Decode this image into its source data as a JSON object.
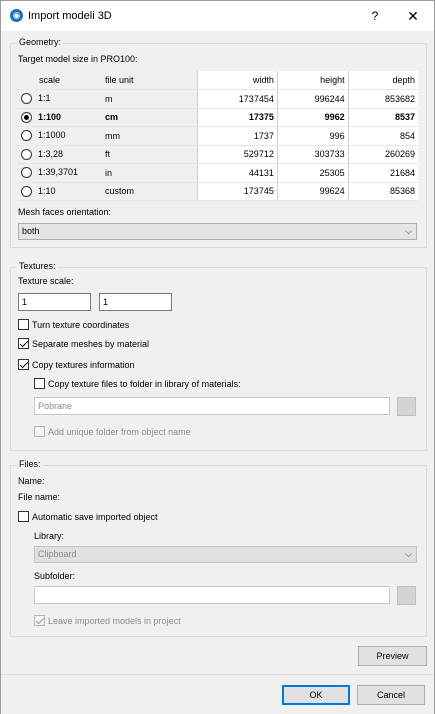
{
  "window": {
    "title": "Import modeli 3D",
    "help": "?",
    "close": "✕"
  },
  "geometry": {
    "group_title": "Geometry:",
    "target_label": "Target model size in PRO100:",
    "headers": {
      "scale": "scale",
      "unit": "file unit",
      "width": "width",
      "height": "height",
      "depth": "depth"
    },
    "rows": [
      {
        "scale": "1:1",
        "unit": "m",
        "width": "1737454",
        "height": "996244",
        "depth": "853682",
        "selected": false
      },
      {
        "scale": "1:100",
        "unit": "cm",
        "width": "17375",
        "height": "9962",
        "depth": "8537",
        "selected": true
      },
      {
        "scale": "1:1000",
        "unit": "mm",
        "width": "1737",
        "height": "996",
        "depth": "854",
        "selected": false
      },
      {
        "scale": "1:3,28",
        "unit": "ft",
        "width": "529712",
        "height": "303733",
        "depth": "260269",
        "selected": false
      },
      {
        "scale": "1:39,3701",
        "unit": "in",
        "width": "44131",
        "height": "25305",
        "depth": "21684",
        "selected": false
      },
      {
        "scale": "1:10",
        "unit": "custom",
        "width": "173745",
        "height": "99624",
        "depth": "85368",
        "selected": false
      }
    ],
    "mesh_label": "Mesh faces orientation:",
    "mesh_value": "both"
  },
  "textures": {
    "group_title": "Textures:",
    "scale_label": "Texture scale:",
    "scale_x": "1",
    "scale_y": "1",
    "turn_coords": "Turn texture coordinates",
    "separate_meshes": "Separate meshes by material",
    "copy_info": "Copy textures information",
    "copy_files": "Copy texture files to folder in library of materials:",
    "folder_value": "Pobrane",
    "unique_folder": "Add unique folder from object name"
  },
  "files": {
    "group_title": "Files:",
    "name_label": "Name:",
    "file_name_label": "File name:",
    "auto_save": "Automatic save imported object",
    "library_label": "Library:",
    "library_value": "Clipboard",
    "subfolder_label": "Subfolder:",
    "subfolder_value": "",
    "leave_models": "Leave imported models in project"
  },
  "buttons": {
    "preview": "Preview",
    "ok": "OK",
    "cancel": "Cancel"
  },
  "colors": {
    "accent": "#0078d7",
    "title_icon": "#1f6fb5"
  }
}
